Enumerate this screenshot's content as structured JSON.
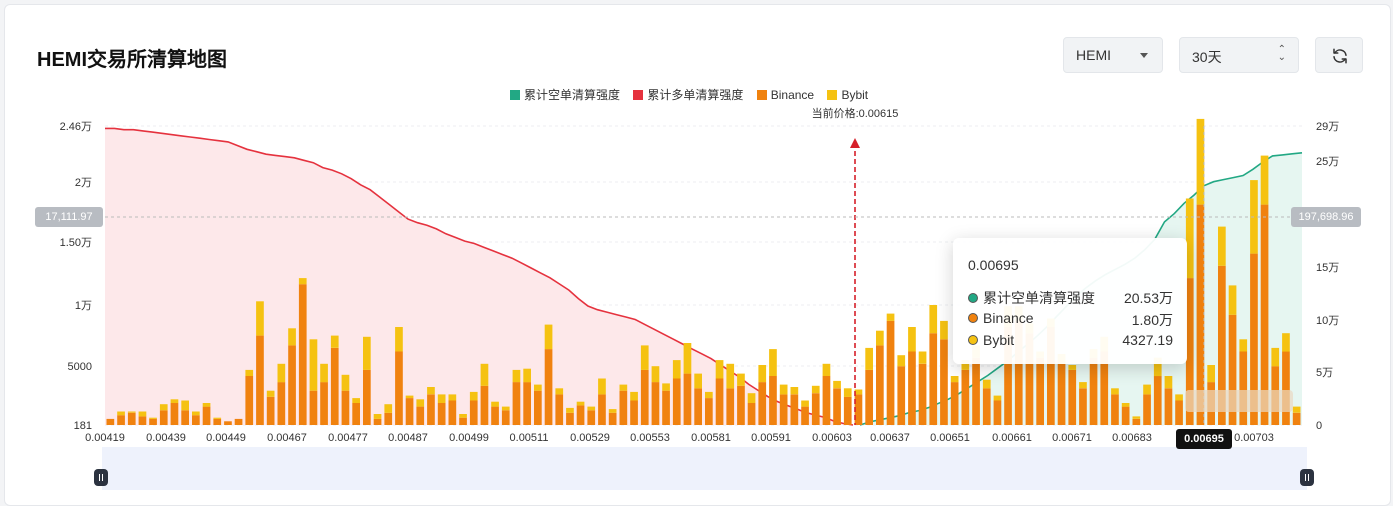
{
  "header": {
    "title": "HEMI交易所清算地图",
    "coin_select": "HEMI",
    "period_select": "30天"
  },
  "legend": [
    {
      "label": "累计空单清算强度",
      "color": "#22a884"
    },
    {
      "label": "累计多单清算强度",
      "color": "#e5323e"
    },
    {
      "label": "Binance",
      "color": "#f0820f"
    },
    {
      "label": "Bybit",
      "color": "#f5c211"
    }
  ],
  "current_price_label": "当前价格:0.00615",
  "crosshair": {
    "left_value": "17,111.97",
    "right_value": "197,698.96",
    "x_value": "0.00695"
  },
  "tooltip": {
    "price": "0.00695",
    "rows": [
      {
        "label": "累计空单清算强度",
        "value": "20.53万",
        "color": "#22a884"
      },
      {
        "label": "Binance",
        "value": "1.80万",
        "color": "#f0820f"
      },
      {
        "label": "Bybit",
        "value": "4327.19",
        "color": "#f5c211"
      }
    ]
  },
  "chart_data": {
    "type": "bar",
    "current_price": 0.00615,
    "left_axis": {
      "ticks": [
        "2.46万",
        "2万",
        "1.50万",
        "1万",
        "5000",
        "181"
      ],
      "range": [
        181,
        24600
      ]
    },
    "right_axis": {
      "ticks": [
        "29万",
        "25万",
        "20万",
        "15万",
        "10万",
        "5万",
        "0"
      ],
      "range": [
        0,
        290000
      ]
    },
    "x_tick_labels": [
      "0.00419",
      "0.00439",
      "0.00449",
      "0.00467",
      "0.00477",
      "0.00487",
      "0.00499",
      "0.00511",
      "0.00529",
      "0.00553",
      "0.00581",
      "0.00591",
      "0.00603",
      "0.00637",
      "0.00651",
      "0.00661",
      "0.00671",
      "0.00683",
      "0.00695",
      "0.00703"
    ],
    "binance": [
      500,
      800,
      1000,
      700,
      500,
      1200,
      1800,
      1200,
      800,
      1500,
      500,
      300,
      500,
      4000,
      7300,
      2300,
      3500,
      6500,
      11500,
      2800,
      3500,
      6300,
      2800,
      1800,
      4500,
      500,
      1000,
      6000,
      2200,
      1500,
      2500,
      1800,
      2000,
      600,
      2000,
      3200,
      1500,
      1200,
      3500,
      3500,
      2800,
      6200,
      2500,
      1000,
      1600,
      1200,
      2500,
      1000,
      2800,
      2000,
      4500,
      3500,
      2800,
      3800,
      4200,
      3000,
      2200,
      3800,
      3000,
      3200,
      1800,
      3500,
      4000,
      2500,
      2500,
      1500,
      2600,
      4000,
      3000,
      2300,
      2500,
      4500,
      6500,
      8500,
      4800,
      6000,
      5000,
      7500,
      7000,
      3500,
      4500,
      5500,
      3000,
      2000,
      8000,
      8500,
      7500,
      5500,
      8000,
      5000,
      4500,
      3000,
      5500,
      6000,
      2500,
      1500,
      500,
      2500,
      4000,
      3000,
      2000,
      12000,
      18000,
      3500,
      13000,
      9000,
      6000,
      14000,
      18000,
      4800,
      6000,
      1000
    ],
    "bybit": [
      0,
      300,
      100,
      400,
      100,
      500,
      300,
      800,
      300,
      300,
      100,
      0,
      0,
      500,
      2800,
      500,
      1500,
      1400,
      500,
      4200,
      1500,
      1000,
      1300,
      400,
      2700,
      400,
      700,
      2000,
      200,
      600,
      600,
      700,
      500,
      300,
      700,
      1800,
      400,
      300,
      1000,
      1100,
      500,
      2000,
      500,
      400,
      300,
      300,
      1300,
      300,
      500,
      700,
      2000,
      1300,
      600,
      1500,
      2500,
      1200,
      500,
      1500,
      2000,
      1000,
      800,
      1400,
      2200,
      800,
      600,
      500,
      600,
      1000,
      600,
      700,
      400,
      1800,
      1200,
      600,
      900,
      2000,
      1000,
      2300,
      1500,
      500,
      800,
      1000,
      700,
      400,
      1700,
      1200,
      800,
      500,
      700,
      800,
      400,
      500,
      700,
      1200,
      500,
      300,
      200,
      800,
      1500,
      1000,
      500,
      6500,
      7000,
      1400,
      3200,
      2400,
      1000,
      6000,
      4000,
      1500,
      1500,
      500
    ],
    "long_curve": [
      24400,
      24400,
      24300,
      24300,
      24200,
      24100,
      24000,
      23900,
      23800,
      23700,
      23600,
      23500,
      23400,
      23300,
      23000,
      22700,
      22500,
      22300,
      22200,
      22100,
      22000,
      21800,
      21600,
      21200,
      21000,
      20700,
      20300,
      19800,
      19400,
      18800,
      18200,
      17600,
      17000,
      16700,
      16500,
      16200,
      15800,
      15500,
      15200,
      15000,
      14700,
      14400,
      14100,
      13800,
      13400,
      13000,
      12600,
      12200,
      11700,
      11200,
      10500,
      9900,
      9600,
      9400,
      9200,
      9000,
      8800,
      8400,
      8000,
      7600,
      7200,
      6800,
      6400,
      6000,
      5600,
      5100,
      4600,
      4100,
      3500,
      3000,
      2500,
      2100,
      1800,
      1500,
      1200,
      1000,
      800,
      500,
      300,
      181
    ],
    "short_curve": [
      0,
      3000,
      5000,
      7000,
      9000,
      12000,
      14000,
      17000,
      21000,
      25000,
      30000,
      36000,
      42000,
      48000,
      55000,
      62000,
      70000,
      78000,
      86000,
      95000,
      105000,
      115000,
      125000,
      133000,
      140000,
      146000,
      151000,
      156000,
      162000,
      170000,
      180000,
      197000,
      205000,
      215000,
      223000,
      232000,
      236000,
      238000,
      240000,
      242000,
      248000,
      255000,
      261000,
      262000,
      263000,
      264000
    ]
  }
}
